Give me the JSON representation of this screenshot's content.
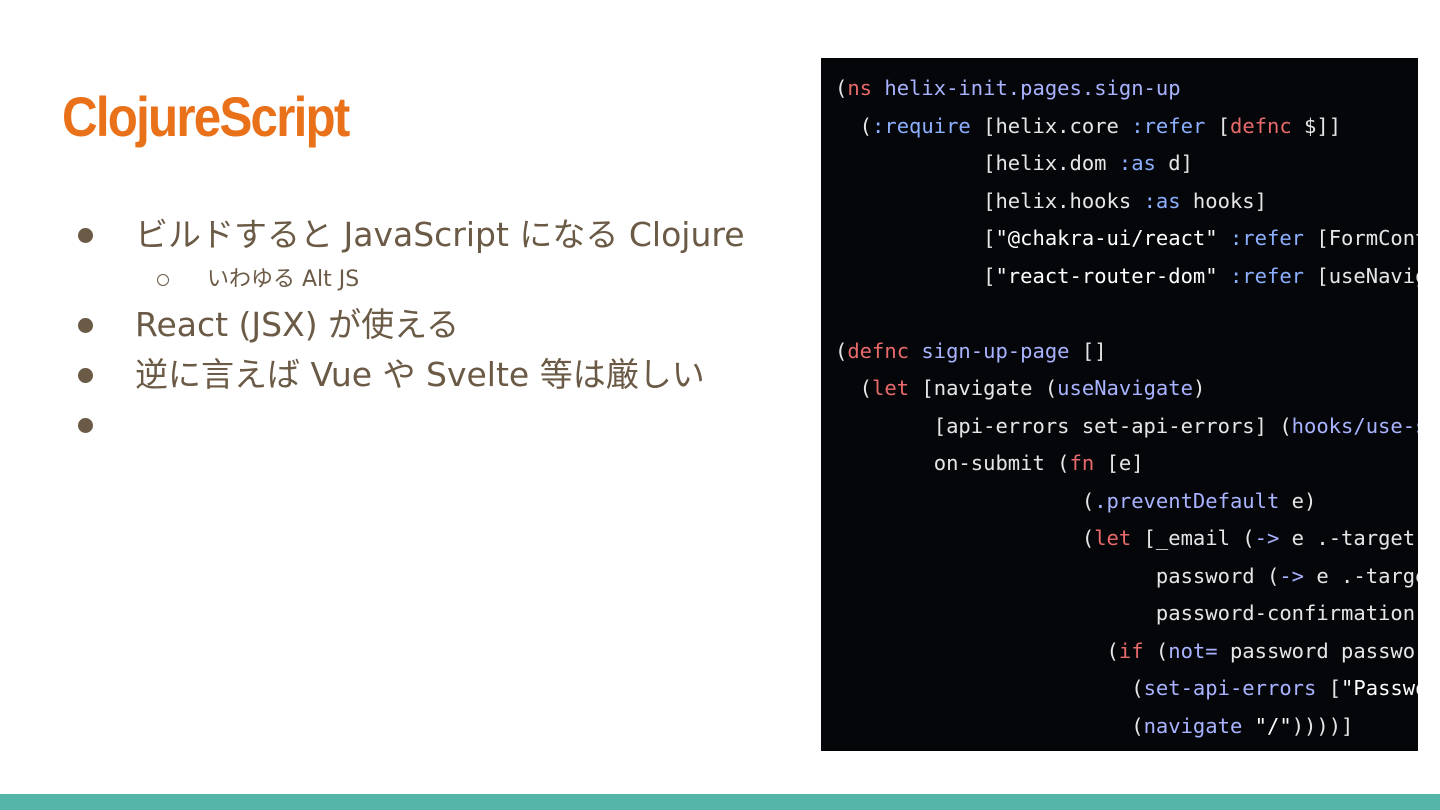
{
  "slide": {
    "title": "ClojureScript",
    "bullets": [
      {
        "text": "ビルドすると JavaScript になる Clojure",
        "subbullets": [
          "いわゆる Alt JS"
        ]
      },
      {
        "text": "React (JSX) が使える",
        "subbullets": []
      },
      {
        "text": "逆に言えば Vue や Svelte 等は厳しい",
        "subbullets": []
      },
      {
        "text": "",
        "subbullets": []
      }
    ]
  },
  "code_image": {
    "lines": [
      [
        {
          "t": "(",
          "c": ""
        },
        {
          "t": "ns",
          "c": "kw"
        },
        {
          "t": " helix-init.pages.sign-up",
          "c": "fn"
        }
      ],
      [
        {
          "t": "  (",
          "c": ""
        },
        {
          "t": ":require",
          "c": "sym"
        },
        {
          "t": " [helix.core ",
          "c": ""
        },
        {
          "t": ":refer",
          "c": "sym"
        },
        {
          "t": " [",
          "c": ""
        },
        {
          "t": "defnc",
          "c": "kw"
        },
        {
          "t": " $]]",
          "c": ""
        }
      ],
      [
        {
          "t": "            [helix.dom ",
          "c": ""
        },
        {
          "t": ":as",
          "c": "sym"
        },
        {
          "t": " d]",
          "c": ""
        }
      ],
      [
        {
          "t": "            [helix.hooks ",
          "c": ""
        },
        {
          "t": ":as",
          "c": "sym"
        },
        {
          "t": " hooks]",
          "c": ""
        }
      ],
      [
        {
          "t": "            [",
          "c": ""
        },
        {
          "t": "\"@chakra-ui/react\"",
          "c": "str"
        },
        {
          "t": " ",
          "c": ""
        },
        {
          "t": ":refer",
          "c": "sym"
        },
        {
          "t": " [FormControl",
          "c": ""
        }
      ],
      [
        {
          "t": "            [",
          "c": ""
        },
        {
          "t": "\"react-router-dom\"",
          "c": "str"
        },
        {
          "t": " ",
          "c": ""
        },
        {
          "t": ":refer",
          "c": "sym"
        },
        {
          "t": " [useNavigate",
          "c": ""
        }
      ],
      [
        {
          "t": "",
          "c": ""
        }
      ],
      [
        {
          "t": "(",
          "c": ""
        },
        {
          "t": "defnc",
          "c": "kw"
        },
        {
          "t": " sign-up-page",
          "c": "fn"
        },
        {
          "t": " []",
          "c": ""
        }
      ],
      [
        {
          "t": "  (",
          "c": ""
        },
        {
          "t": "let",
          "c": "kw"
        },
        {
          "t": " [navigate (",
          "c": ""
        },
        {
          "t": "useNavigate",
          "c": "fn"
        },
        {
          "t": ")",
          "c": ""
        }
      ],
      [
        {
          "t": "        [api-errors set-api-errors] (",
          "c": ""
        },
        {
          "t": "hooks/use-state",
          "c": "fn"
        }
      ],
      [
        {
          "t": "        on-submit (",
          "c": ""
        },
        {
          "t": "fn",
          "c": "kw"
        },
        {
          "t": " [e]",
          "c": ""
        }
      ],
      [
        {
          "t": "                    (",
          "c": ""
        },
        {
          "t": ".preventDefault",
          "c": "fn"
        },
        {
          "t": " e)",
          "c": ""
        }
      ],
      [
        {
          "t": "                    (",
          "c": ""
        },
        {
          "t": "let",
          "c": "kw"
        },
        {
          "t": " [_email (",
          "c": ""
        },
        {
          "t": "->",
          "c": "fn"
        },
        {
          "t": " e .-target",
          "c": ""
        }
      ],
      [
        {
          "t": "                          password (",
          "c": ""
        },
        {
          "t": "->",
          "c": "fn"
        },
        {
          "t": " e .-target",
          "c": ""
        }
      ],
      [
        {
          "t": "                          password-confirmation",
          "c": ""
        }
      ],
      [
        {
          "t": "                      (",
          "c": ""
        },
        {
          "t": "if",
          "c": "kw"
        },
        {
          "t": " (",
          "c": ""
        },
        {
          "t": "not=",
          "c": "fn"
        },
        {
          "t": " password password",
          "c": ""
        }
      ],
      [
        {
          "t": "                        (",
          "c": ""
        },
        {
          "t": "set-api-errors",
          "c": "fn"
        },
        {
          "t": " [",
          "c": ""
        },
        {
          "t": "\"Password",
          "c": "str"
        }
      ],
      [
        {
          "t": "                        (",
          "c": ""
        },
        {
          "t": "navigate",
          "c": "fn"
        },
        {
          "t": " ",
          "c": ""
        },
        {
          "t": "\"/\"",
          "c": "str"
        },
        {
          "t": "))))]",
          "c": ""
        }
      ]
    ]
  },
  "colors": {
    "title": "#e8711a",
    "body_text": "#6b5a45",
    "code_background": "#04060a",
    "code_keyword": "#e86a6a",
    "code_function": "#a9b3ff",
    "code_keyword_symbol": "#8cb0ff",
    "footer_bar": "#54b6a8"
  }
}
